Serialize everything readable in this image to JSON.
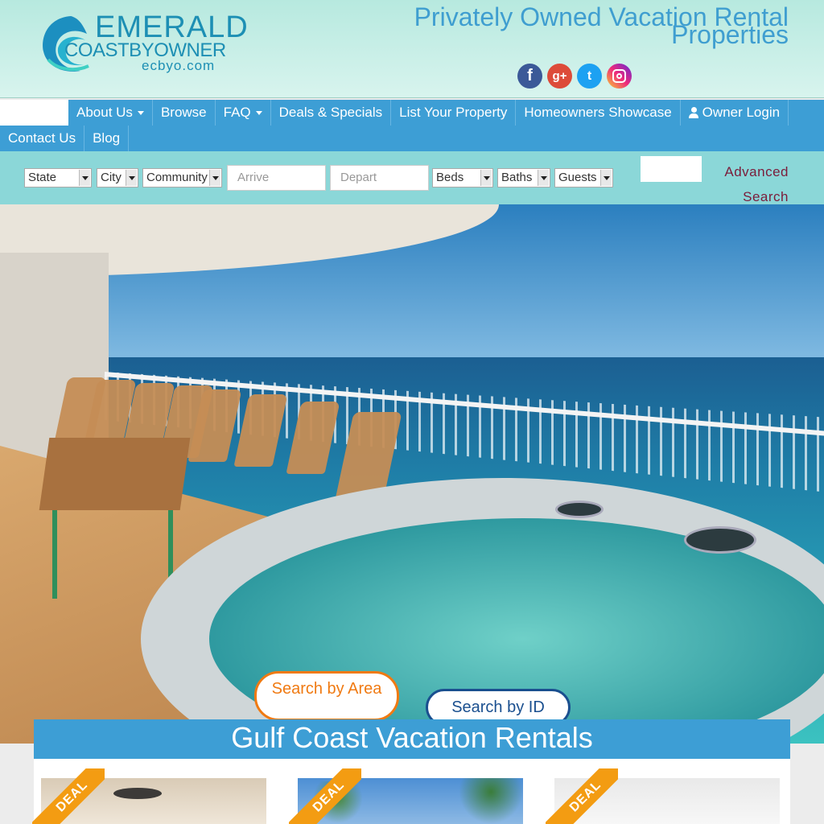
{
  "logo": {
    "line1": "EMERALD",
    "line2": "COASTBYOWNER",
    "line3": "ecbyo.com"
  },
  "header": {
    "tagline_1": "Privately Owned Vacation Rental",
    "tagline_2": "Properties"
  },
  "social": {
    "facebook": "f",
    "google": "g+",
    "twitter": "t"
  },
  "nav": {
    "row1": [
      "About Us",
      "Browse",
      "FAQ",
      "Deals & Specials",
      "List Your Property",
      "Homeowners Showcase",
      "Owner Login"
    ],
    "row2": [
      "Contact Us",
      "Blog"
    ]
  },
  "search": {
    "state": "State",
    "city": "City",
    "community": "Community",
    "arrive_placeholder": "Arrive",
    "depart_placeholder": "Depart",
    "beds": "Beds",
    "baths": "Baths",
    "guests": "Guests",
    "advanced": "Advanced Search"
  },
  "hero": {
    "search_area": "Search by Area",
    "search_id": "Search by ID"
  },
  "section": {
    "title": "Gulf Coast Vacation Rentals",
    "deal_badge": "DEAL"
  },
  "colors": {
    "nav_bg": "#3d9ed5",
    "search_bg": "#8bd7d8",
    "accent_orange": "#f07a12",
    "accent_navy": "#1a4f8f"
  },
  "icons": [
    "facebook-icon",
    "google-plus-icon",
    "twitter-icon",
    "instagram-icon",
    "user-icon",
    "caret-down-icon"
  ]
}
